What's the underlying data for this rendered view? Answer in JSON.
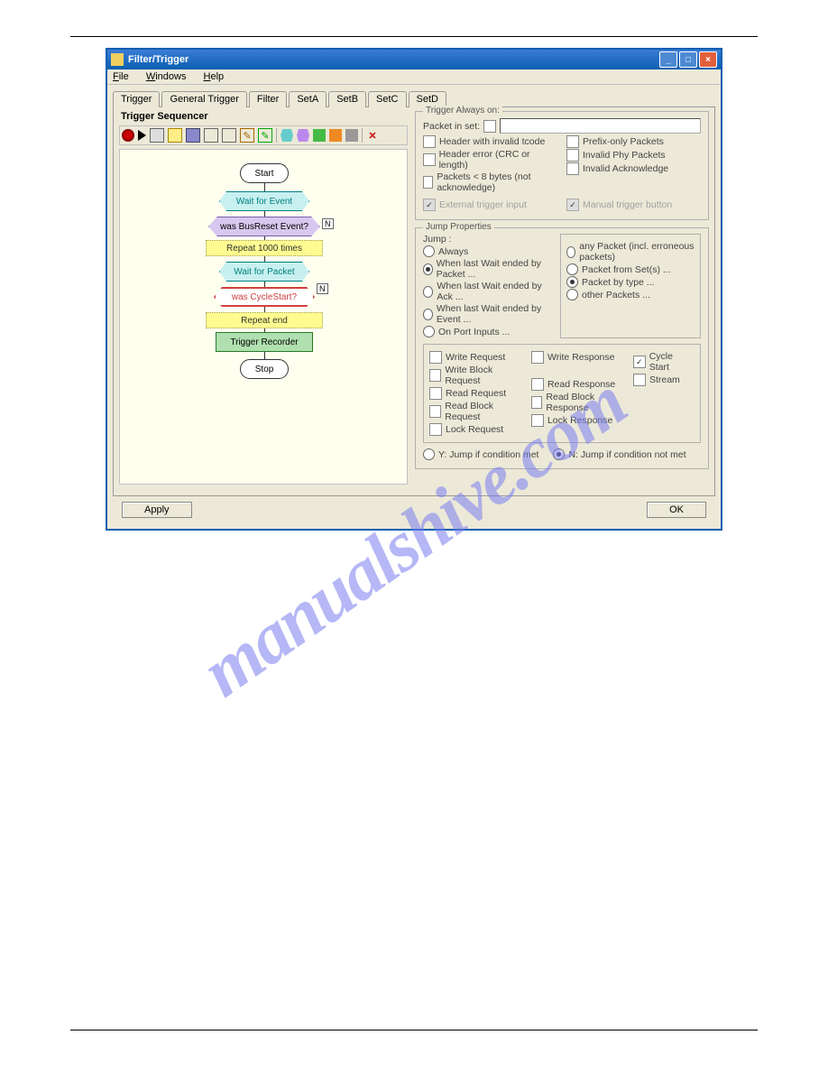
{
  "watermark": "manualshive.com",
  "window": {
    "title": "Filter/Trigger",
    "menu": {
      "file": "File",
      "windows": "Windows",
      "help": "Help"
    }
  },
  "tabs": [
    "Trigger",
    "General Trigger",
    "Filter",
    "SetA",
    "SetB",
    "SetC",
    "SetD"
  ],
  "sequencer": {
    "title": "Trigger Sequencer",
    "start": "Start",
    "wait_event": "Wait for Event",
    "busreset": "was BusReset Event?",
    "repeat": "Repeat 1000 times",
    "wait_packet": "Wait for Packet",
    "cyclestart": "was CycleStart?",
    "repeat_end": "Repeat end",
    "trigger_recorder": "Trigger Recorder",
    "stop": "Stop",
    "n_tag": "N"
  },
  "trigger_always": {
    "legend": "Trigger Always on:",
    "packet_in_set": "Packet in set:",
    "left": [
      "Header with invalid tcode",
      "Header error (CRC or length)",
      "Packets < 8 bytes (not acknowledge)"
    ],
    "right": [
      "Prefix-only Packets",
      "Invalid Phy Packets",
      "Invalid Acknowledge"
    ],
    "ext_trigger": "External trigger input",
    "manual_trigger": "Manual trigger button"
  },
  "jump_props": {
    "legend": "Jump Properties",
    "jump_label": "Jump :",
    "left_radios": [
      "Always",
      "When last Wait ended by Packet ...",
      "When last Wait ended by Ack ...",
      "When last Wait ended by Event ...",
      "On Port Inputs ..."
    ],
    "left_selected": "When last Wait ended by Packet ...",
    "right_radios": [
      "any Packet (incl. erroneous packets)",
      "Packet from Set(s) ...",
      "Packet by type ...",
      "other Packets ..."
    ],
    "right_selected": "Packet by type ...",
    "type_checks": {
      "col1": [
        "Write Request",
        "Write Block Request",
        "Read Request",
        "Read Block Request",
        "Lock Request"
      ],
      "col2": [
        "Write Response",
        "",
        "Read Response",
        "Read Block Response",
        "Lock Response"
      ],
      "col3": [
        "Cycle Start",
        "Stream"
      ]
    },
    "col3_checked": "Cycle Start",
    "yn_y": "Y: Jump if condition met",
    "yn_n": "N: Jump if condition not met",
    "yn_selected": "N"
  },
  "buttons": {
    "apply": "Apply",
    "ok": "OK"
  }
}
